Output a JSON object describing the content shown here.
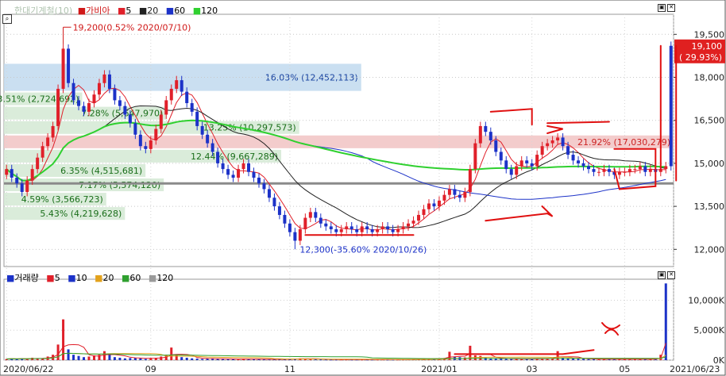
{
  "price_legend": {
    "title": "한대기계철(10)",
    "main": "가비아",
    "ma": [
      {
        "label": "5",
        "color": "#e0202a"
      },
      {
        "label": "20",
        "color": "#222222"
      },
      {
        "label": "60",
        "color": "#1c32c8"
      },
      {
        "label": "120",
        "color": "#2fd02f"
      }
    ]
  },
  "volume_legend": {
    "title": "거래량",
    "ma": [
      {
        "label": "5",
        "color": "#e0202a"
      },
      {
        "label": "10",
        "color": "#1c32c8"
      },
      {
        "label": "20",
        "color": "#e3a21c"
      },
      {
        "label": "60",
        "color": "#2fa02f"
      },
      {
        "label": "120",
        "color": "#9a9a9a"
      }
    ]
  },
  "chart_data": [
    {
      "type": "candlestick",
      "price_axis": {
        "ticks": [
          "19,500",
          "18,000",
          "16,500",
          "15,000",
          "13,500",
          "12,000"
        ],
        "range": [
          11400,
          20200
        ]
      },
      "current_price": {
        "value": "19,100",
        "change": "( 29.93%)"
      },
      "high_annotation": "19,200(0.52% 2020/07/10)",
      "low_annotation": "12,300(-35.60% 2020/10/26)",
      "volume_profile": [
        {
          "label": "16.03% (12,452,113)",
          "low": 17500,
          "high": 18500
        },
        {
          "label": "3.51% (2,724,692)",
          "low": 17000,
          "high": 17500
        },
        {
          "label": "7.28% (5,647,970)",
          "low": 16500,
          "high": 17000
        },
        {
          "label": "13.25% (10,297,573)",
          "low": 16000,
          "high": 16500
        },
        {
          "label": "21.92% (17,030,279)",
          "low": 15500,
          "high": 16000
        },
        {
          "label": "12.44% (9,667,289)",
          "low": 15000,
          "high": 15500
        },
        {
          "label": "6.35% (4,515,681)",
          "low": 14500,
          "high": 15000
        },
        {
          "label": "7.17% (5,574,120)",
          "low": 14000,
          "high": 14500
        },
        {
          "label": "4.59% (3,566,723)",
          "low": 13500,
          "high": 14000
        },
        {
          "label": "5.43% (4,219,628)",
          "low": 13000,
          "high": 13500
        }
      ],
      "close": [
        14800,
        14500,
        14300,
        14000,
        14400,
        14800,
        15200,
        15600,
        15900,
        16300,
        17600,
        19000,
        17800,
        17200,
        17000,
        16800,
        17100,
        17400,
        17800,
        18100,
        17600,
        17200,
        17000,
        16700,
        16400,
        16000,
        15600,
        15500,
        15800,
        16200,
        16700,
        17200,
        17600,
        17900,
        17500,
        17100,
        16800,
        16300,
        16000,
        15700,
        15400,
        15000,
        14800,
        14600,
        14500,
        14800,
        15000,
        14700,
        14500,
        14300,
        14100,
        13800,
        13500,
        13200,
        12900,
        12600,
        12300,
        12700,
        13100,
        13300,
        13100,
        12900,
        12800,
        12700,
        12600,
        12700,
        12800,
        12700,
        12600,
        12800,
        12700,
        12600,
        12700,
        12800,
        12700,
        12600,
        12700,
        12800,
        12900,
        13000,
        13200,
        13400,
        13600,
        13500,
        13700,
        13900,
        14100,
        13900,
        13800,
        14000,
        14800,
        15700,
        16300,
        16100,
        15800,
        15400,
        15100,
        14800,
        14600,
        14900,
        15100,
        15000,
        14900,
        15300,
        15600,
        15700,
        15800,
        15900,
        15600,
        15300,
        15100,
        15000,
        14900,
        14800,
        14700,
        14700,
        14800,
        14700,
        14600,
        14700,
        14700,
        14800,
        14800,
        14900,
        14700,
        14800,
        14700,
        14800,
        14900,
        19100
      ],
      "x_ticks": [
        "2020/06/22",
        "09",
        "11",
        "2021/01",
        "03",
        "05",
        "2021/06/23"
      ]
    },
    {
      "type": "bar",
      "name": "volume",
      "y_ticks": [
        "10,000K",
        "5,000K",
        "0K"
      ],
      "range": [
        0,
        13500
      ],
      "values": [
        200,
        250,
        180,
        300,
        200,
        400,
        300,
        250,
        600,
        900,
        2600,
        6800,
        1800,
        900,
        700,
        500,
        600,
        800,
        900,
        1500,
        900,
        500,
        400,
        300,
        350,
        400,
        300,
        200,
        350,
        400,
        600,
        900,
        2100,
        800,
        500,
        400,
        300,
        250,
        200,
        250,
        300,
        200,
        180,
        160,
        150,
        200,
        220,
        180,
        150,
        150,
        130,
        150,
        160,
        150,
        170,
        200,
        250,
        300,
        250,
        200,
        150,
        120,
        110,
        100,
        100,
        110,
        120,
        100,
        100,
        110,
        100,
        100,
        110,
        120,
        100,
        100,
        110,
        120,
        130,
        150,
        200,
        220,
        300,
        250,
        260,
        350,
        1400,
        600,
        500,
        450,
        2400,
        800,
        700,
        400,
        300,
        250,
        230,
        200,
        180,
        200,
        220,
        200,
        180,
        250,
        300,
        280,
        320,
        1500,
        400,
        300,
        250,
        220,
        200,
        180,
        170,
        160,
        180,
        170,
        160,
        170,
        180,
        170,
        160,
        170,
        180,
        170,
        160,
        900,
        12800
      ]
    }
  ]
}
